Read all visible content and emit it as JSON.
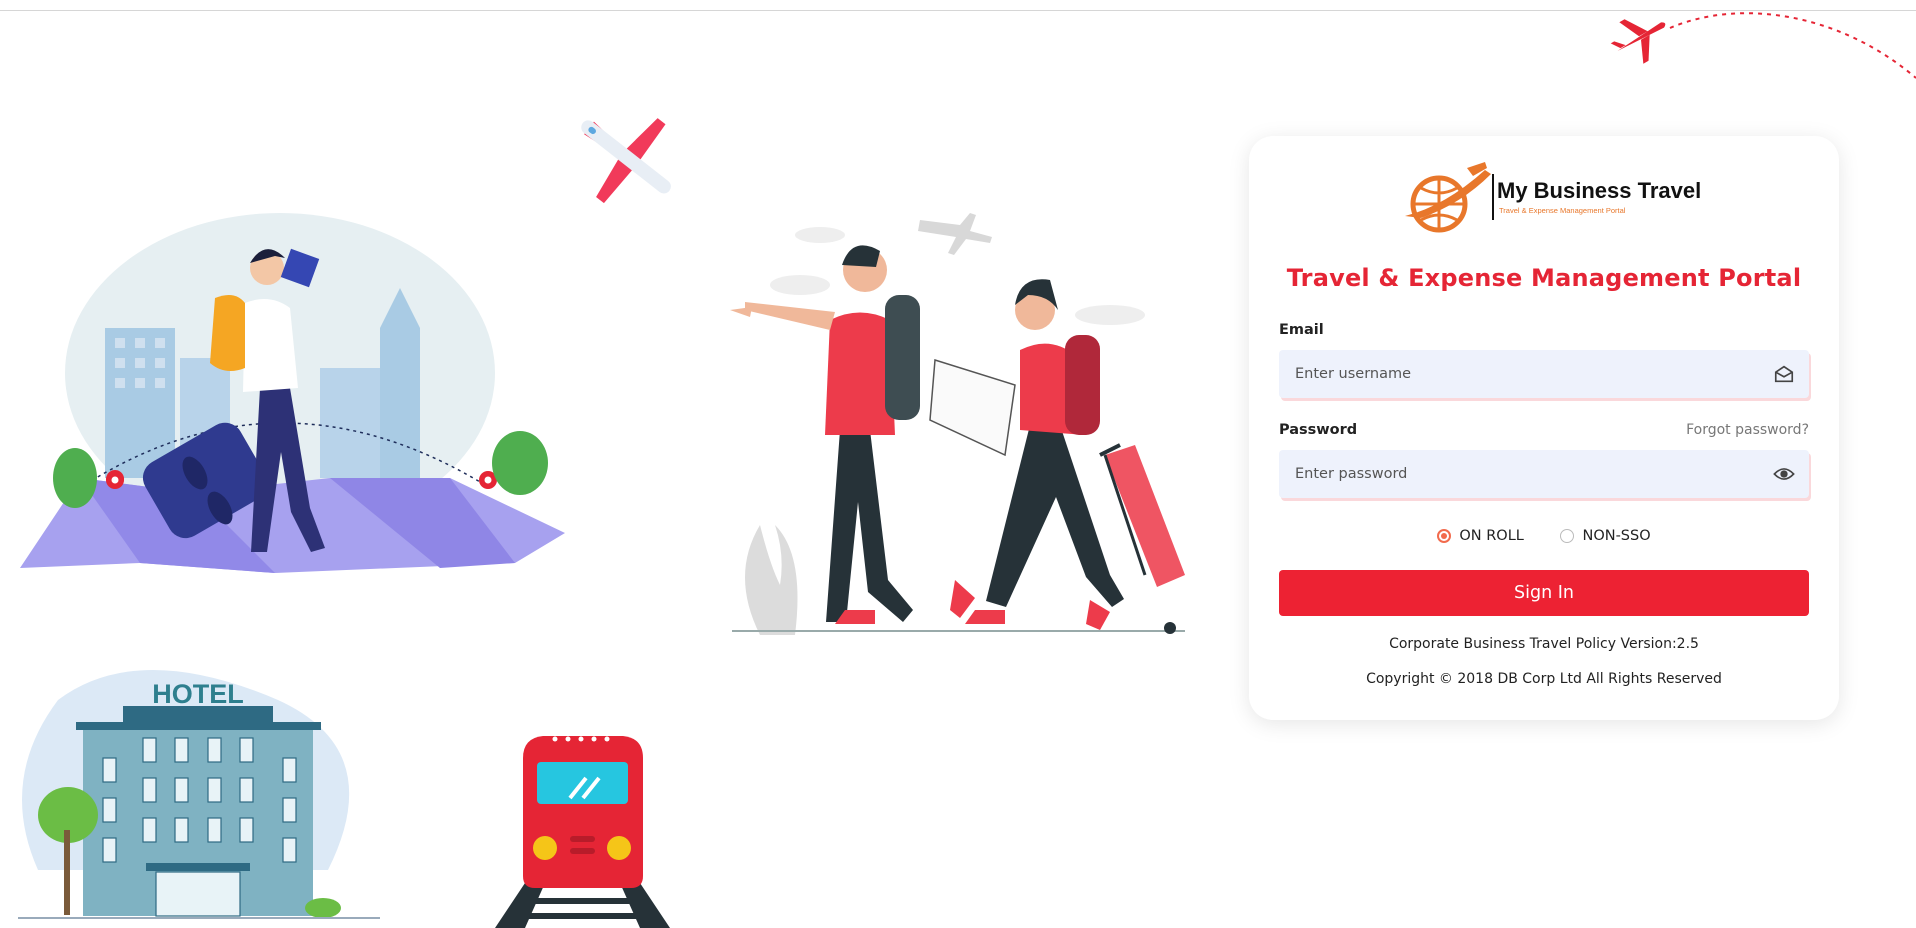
{
  "brand": {
    "name": "My Business Travel",
    "tagline": "Travel & Expense Management Portal",
    "accent": "#ed2233",
    "logo_color": "#e8772b"
  },
  "portal_title": "Travel & Expense Management Portal",
  "email": {
    "label": "Email",
    "placeholder": "Enter username",
    "value": "",
    "icon": "envelope-open-icon"
  },
  "password": {
    "label": "Password",
    "placeholder": "Enter password",
    "value": "",
    "icon": "eye-icon",
    "forgot_label": "Forgot password?"
  },
  "login_type": {
    "options": [
      {
        "label": "ON ROLL",
        "selected": true
      },
      {
        "label": "NON-SSO",
        "selected": false
      }
    ]
  },
  "signin_label": "Sign In",
  "policy_version": "Corporate Business Travel Policy Version:2.5",
  "copyright": "Copyright © 2018 DB Corp Ltd All Rights Reserved",
  "illustrations": {
    "hotel_sign": "HOTEL",
    "items": [
      "airplane-icon",
      "traveler-map-illustration",
      "travelers-couple-illustration",
      "hotel-illustration",
      "train-illustration"
    ]
  }
}
